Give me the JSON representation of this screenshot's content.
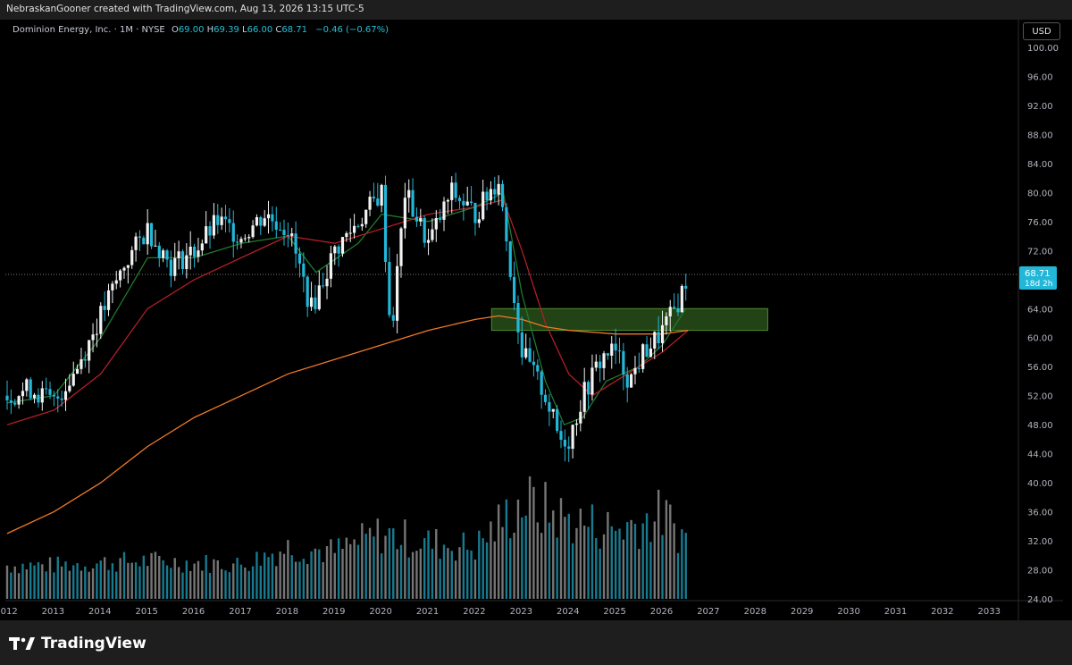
{
  "header": {
    "text": "NebraskanGooner created with TradingView.com, Aug 13, 2026 13:15 UTC-5"
  },
  "legend": {
    "symbol": "Dominion Energy, Inc. · 1M · NYSE",
    "open_label": "O",
    "open": "69.00",
    "high_label": "H",
    "high": "69.39",
    "low_label": "L",
    "low": "66.00",
    "close_label": "C",
    "close": "68.71",
    "change": "−0.46 (−0.67%)"
  },
  "currency_button": "USD",
  "price_tag": {
    "price": "68.71",
    "countdown": "18d 2h"
  },
  "brand": {
    "name": "TradingView"
  },
  "colors": {
    "up": "#f2f2f2",
    "down": "#22b7d8",
    "ma_fast": "#1e7a2e",
    "ma_mid": "#b01f28",
    "ma_slow": "#f07a28",
    "zone": "#2e5a1e",
    "zone_border": "#4f8a2e",
    "price_tag": "#22b7d8",
    "axis_text": "#b2b5be"
  },
  "chart_data": {
    "type": "candlestick",
    "interval": "1M",
    "ylim": [
      24,
      100
    ],
    "y_ticks": [
      "24.00",
      "28.00",
      "32.00",
      "36.00",
      "40.00",
      "44.00",
      "48.00",
      "52.00",
      "56.00",
      "60.00",
      "64.00",
      "68.00",
      "72.00",
      "76.00",
      "80.00",
      "84.00",
      "88.00",
      "92.00",
      "96.00",
      "100.00"
    ],
    "x_labels": [
      "2012",
      "2013",
      "2014",
      "2015",
      "2016",
      "2017",
      "2018",
      "2019",
      "2020",
      "2021",
      "2022",
      "2023",
      "2024",
      "2025",
      "2026",
      "2027",
      "2028",
      "2029",
      "2030",
      "2031",
      "2032",
      "2033"
    ],
    "x_range": [
      2012,
      2033.3
    ],
    "price_points": [
      [
        2012.0,
        52
      ],
      [
        2012.5,
        53
      ],
      [
        2013.0,
        51
      ],
      [
        2013.5,
        56
      ],
      [
        2014.0,
        63
      ],
      [
        2014.5,
        70
      ],
      [
        2015.0,
        75
      ],
      [
        2015.5,
        70
      ],
      [
        2016.0,
        72
      ],
      [
        2016.5,
        76
      ],
      [
        2017.0,
        74
      ],
      [
        2017.5,
        77
      ],
      [
        2018.0,
        75
      ],
      [
        2018.5,
        64
      ],
      [
        2019.0,
        72
      ],
      [
        2019.5,
        76
      ],
      [
        2020.0,
        80
      ],
      [
        2020.2,
        60
      ],
      [
        2020.5,
        80
      ],
      [
        2021.0,
        73
      ],
      [
        2021.5,
        80
      ],
      [
        2022.0,
        77
      ],
      [
        2022.5,
        82
      ],
      [
        2022.8,
        67
      ],
      [
        2023.0,
        58
      ],
      [
        2023.5,
        52
      ],
      [
        2023.8,
        46
      ],
      [
        2024.0,
        46
      ],
      [
        2024.3,
        52
      ],
      [
        2024.6,
        56
      ],
      [
        2024.8,
        58
      ],
      [
        2025.0,
        58
      ],
      [
        2025.3,
        54
      ],
      [
        2025.6,
        58
      ],
      [
        2025.9,
        60
      ],
      [
        2026.2,
        63
      ],
      [
        2026.4,
        66
      ],
      [
        2026.55,
        68.71
      ]
    ],
    "volume_profile": [
      [
        2012.0,
        0.25
      ],
      [
        2013.0,
        0.25
      ],
      [
        2014.0,
        0.28
      ],
      [
        2015.0,
        0.3
      ],
      [
        2016.0,
        0.28
      ],
      [
        2017.0,
        0.26
      ],
      [
        2018.0,
        0.45
      ],
      [
        2019.0,
        0.4
      ],
      [
        2020.0,
        0.6
      ],
      [
        2021.0,
        0.5
      ],
      [
        2022.0,
        0.45
      ],
      [
        2023.0,
        0.95
      ],
      [
        2024.0,
        0.75
      ],
      [
        2025.0,
        0.65
      ],
      [
        2026.0,
        0.8
      ],
      [
        2026.6,
        0.5
      ]
    ],
    "series": [
      {
        "name": "",
        "kind": "ma_fast",
        "points": [
          [
            2012.0,
            51
          ],
          [
            2013.0,
            52
          ],
          [
            2014.0,
            60
          ],
          [
            2015.0,
            71
          ],
          [
            2016.0,
            71
          ],
          [
            2017.0,
            73
          ],
          [
            2018.0,
            74
          ],
          [
            2018.6,
            69
          ],
          [
            2019.5,
            73
          ],
          [
            2020.0,
            77
          ],
          [
            2021.0,
            76
          ],
          [
            2022.0,
            78
          ],
          [
            2022.6,
            80
          ],
          [
            2023.0,
            66
          ],
          [
            2023.5,
            54
          ],
          [
            2023.9,
            48
          ],
          [
            2024.3,
            49
          ],
          [
            2024.8,
            54
          ],
          [
            2025.5,
            56
          ],
          [
            2026.0,
            59
          ],
          [
            2026.5,
            64
          ]
        ]
      },
      {
        "name": "",
        "kind": "ma_mid",
        "points": [
          [
            2012.0,
            48
          ],
          [
            2013.0,
            50
          ],
          [
            2014.0,
            55
          ],
          [
            2015.0,
            64
          ],
          [
            2016.0,
            68
          ],
          [
            2017.0,
            71
          ],
          [
            2018.0,
            74
          ],
          [
            2019.0,
            73
          ],
          [
            2020.0,
            75
          ],
          [
            2021.0,
            77
          ],
          [
            2022.0,
            78
          ],
          [
            2022.6,
            79
          ],
          [
            2023.0,
            72
          ],
          [
            2023.5,
            62
          ],
          [
            2024.0,
            55
          ],
          [
            2024.5,
            52
          ],
          [
            2025.0,
            54
          ],
          [
            2025.5,
            56
          ],
          [
            2026.0,
            58
          ],
          [
            2026.55,
            61
          ]
        ]
      },
      {
        "name": "",
        "kind": "ma_slow",
        "points": [
          [
            2012.0,
            33
          ],
          [
            2013.0,
            36
          ],
          [
            2014.0,
            40
          ],
          [
            2015.0,
            45
          ],
          [
            2016.0,
            49
          ],
          [
            2017.0,
            52
          ],
          [
            2018.0,
            55
          ],
          [
            2019.0,
            57
          ],
          [
            2020.0,
            59
          ],
          [
            2021.0,
            61
          ],
          [
            2022.0,
            62.5
          ],
          [
            2022.5,
            63
          ],
          [
            2023.0,
            62.5
          ],
          [
            2023.5,
            61.5
          ],
          [
            2024.0,
            61
          ],
          [
            2025.0,
            60.5
          ],
          [
            2026.0,
            60.5
          ],
          [
            2026.55,
            61
          ]
        ]
      }
    ],
    "zone": {
      "x_start": 2022.35,
      "x_end": 2028.25,
      "y_low": 61,
      "y_high": 64
    },
    "last_price": 68.71
  }
}
